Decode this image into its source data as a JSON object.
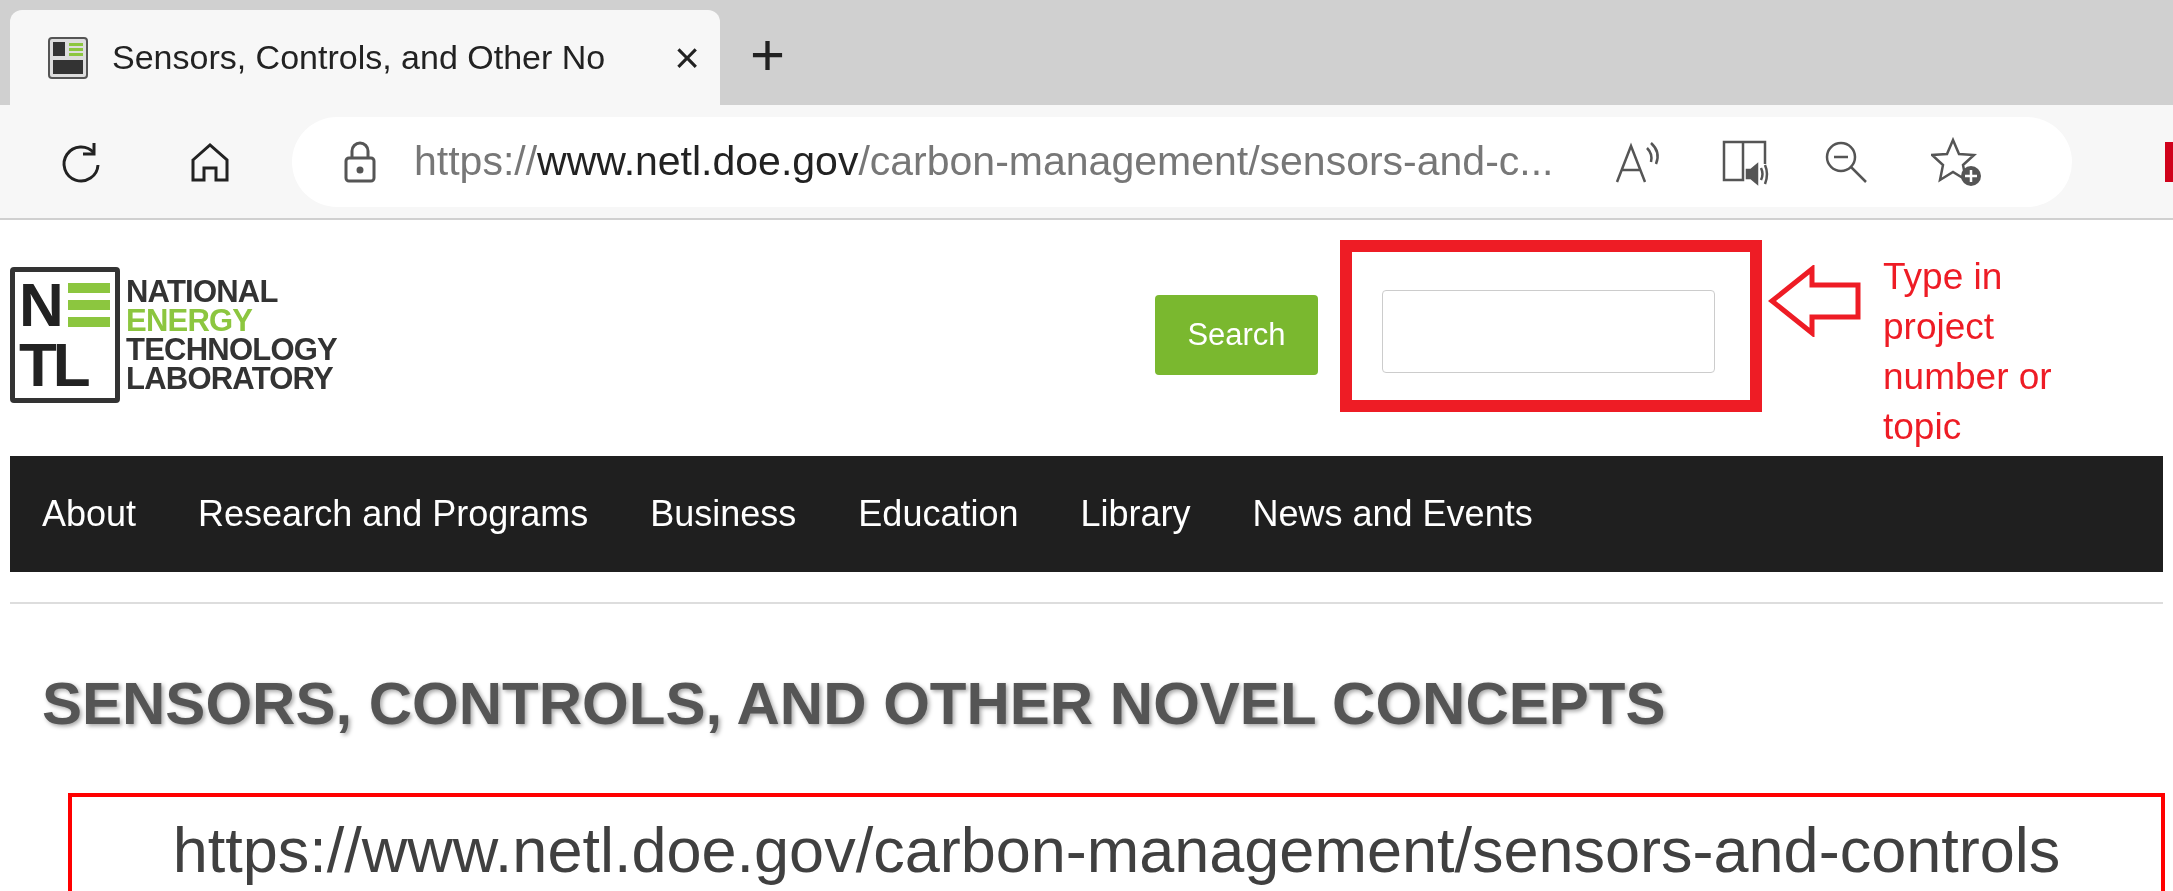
{
  "browser": {
    "tabs": [
      {
        "title": "Sensors, Controls, and Other No",
        "selected": true
      }
    ],
    "new_tab": "+",
    "close": "×",
    "address": {
      "scheme": "https://",
      "host": "www.netl.doe.gov",
      "path": "/carbon-management/sensors-and-c..."
    }
  },
  "header": {
    "logo": {
      "mark_top": "N",
      "mark_bottom": "TL",
      "lines": [
        {
          "text": "NATIONAL",
          "accent": false
        },
        {
          "text": "ENERGY",
          "accent": true
        },
        {
          "text": "TECHNOLOGY",
          "accent": false
        },
        {
          "text": "LABORATORY",
          "accent": false
        }
      ]
    },
    "search_button": "Search"
  },
  "annotation": {
    "note": "Type in project number or topic",
    "url_callout": "https://www.netl.doe.gov/carbon-management/sensors-and-controls"
  },
  "nav": [
    "About",
    "Research and Programs",
    "Business",
    "Education",
    "Library",
    "News and Events"
  ],
  "page_title": "SENSORS, CONTROLS, AND OTHER NOVEL CONCEPTS"
}
